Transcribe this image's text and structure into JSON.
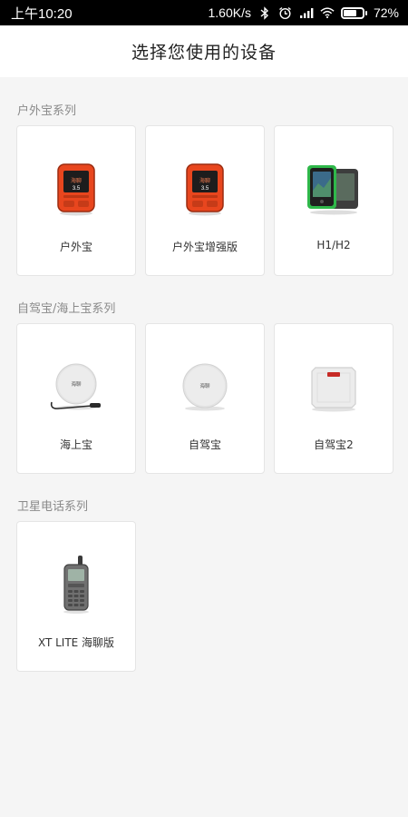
{
  "status_bar": {
    "time": "上午10:20",
    "network_speed": "1.60K/s",
    "battery_percent": "72%",
    "battery_level": 0.72,
    "icons": [
      "bluetooth-icon",
      "alarm-icon",
      "signal-icon",
      "wifi-icon",
      "battery-icon"
    ]
  },
  "header": {
    "title": "选择您使用的设备"
  },
  "sections": [
    {
      "title": "户外宝系列",
      "devices": [
        {
          "label": "户外宝",
          "icon": "outdoor-device-orange"
        },
        {
          "label": "户外宝增强版",
          "icon": "outdoor-device-orange"
        },
        {
          "label": "H1/H2",
          "icon": "rugged-tablet-green"
        }
      ]
    },
    {
      "title": "自驾宝/海上宝系列",
      "devices": [
        {
          "label": "海上宝",
          "icon": "round-antenna-with-cable"
        },
        {
          "label": "自驾宝",
          "icon": "round-antenna"
        },
        {
          "label": "自驾宝2",
          "icon": "square-box-device"
        }
      ]
    },
    {
      "title": "卫星电话系列",
      "devices": [
        {
          "label": "XT LITE 海聊版",
          "icon": "satellite-phone"
        }
      ]
    }
  ],
  "device_print": {
    "brand": "海聊"
  },
  "colors": {
    "accent_orange": "#e8461e",
    "device_green": "#2fb84a",
    "background": "#f5f5f5"
  }
}
